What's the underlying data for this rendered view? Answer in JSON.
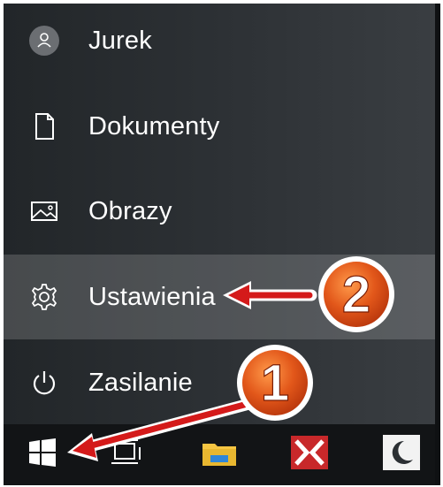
{
  "start_menu": {
    "items": [
      {
        "label": "Jurek",
        "icon": "user-icon"
      },
      {
        "label": "Dokumenty",
        "icon": "document-icon"
      },
      {
        "label": "Obrazy",
        "icon": "pictures-icon"
      },
      {
        "label": "Ustawienia",
        "icon": "gear-icon"
      },
      {
        "label": "Zasilanie",
        "icon": "power-icon"
      }
    ]
  },
  "taskbar": {
    "buttons": [
      {
        "name": "start",
        "icon": "windows-logo-icon"
      },
      {
        "name": "task-view",
        "icon": "task-view-icon"
      },
      {
        "name": "file-explorer",
        "icon": "folder-icon"
      },
      {
        "name": "app",
        "icon": "app-icon"
      },
      {
        "name": "night-mode",
        "icon": "moon-icon"
      }
    ]
  },
  "annotations": {
    "step1": "1",
    "step2": "2"
  },
  "colors": {
    "menu_bg": "#2b2f33",
    "selected_bg": "#4d5155",
    "taskbar_bg": "#121416",
    "badge_orange": "#e2571a",
    "arrow_red": "#d41a1a"
  }
}
